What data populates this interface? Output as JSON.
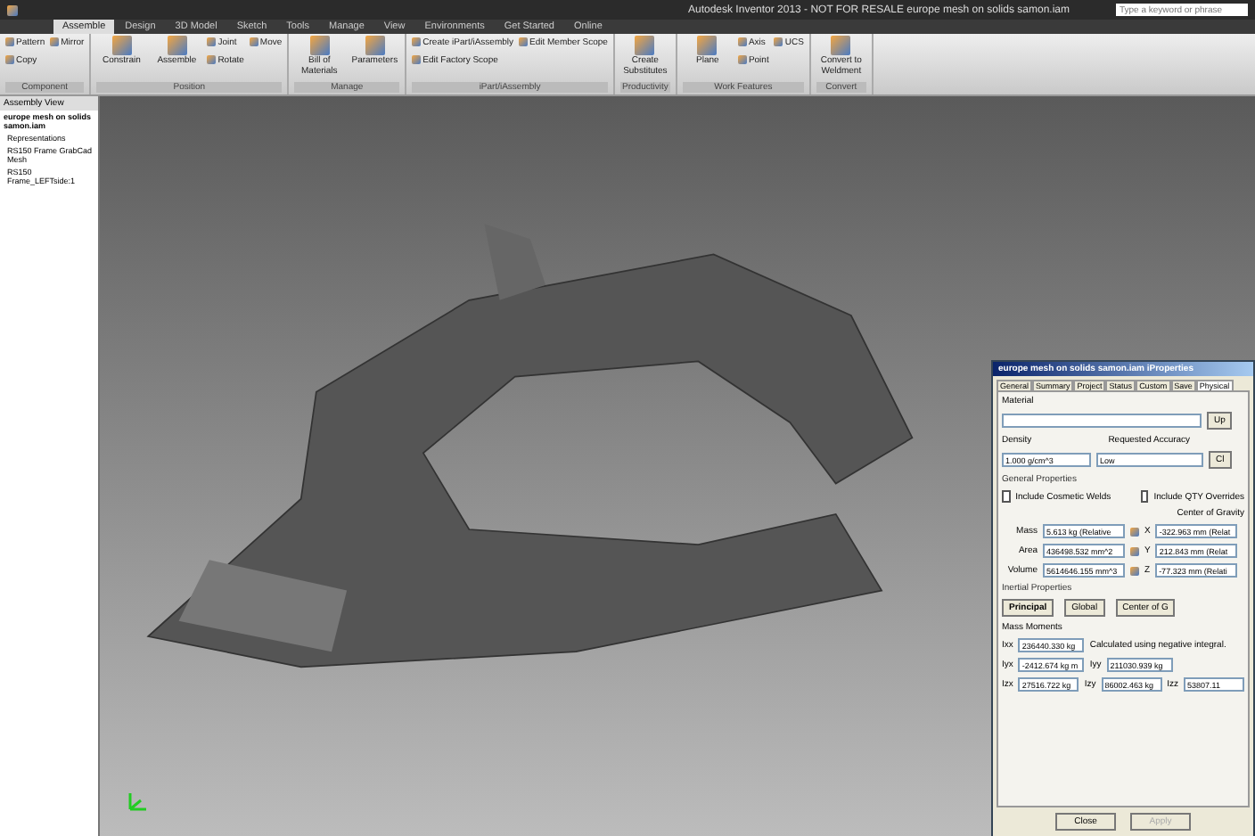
{
  "window": {
    "title": "Autodesk Inventor 2013 - NOT FOR RESALE   europe mesh on solids samon.iam",
    "search": {
      "placeholder": "Type a keyword or phrase"
    }
  },
  "tabs": [
    {
      "label": "Assemble",
      "selected": true
    },
    {
      "label": "Design",
      "selected": false
    },
    {
      "label": "3D Model",
      "selected": false
    },
    {
      "label": "Sketch",
      "selected": false
    },
    {
      "label": "Tools",
      "selected": false
    },
    {
      "label": "Manage",
      "selected": false
    },
    {
      "label": "View",
      "selected": false
    },
    {
      "label": "Environments",
      "selected": false
    },
    {
      "label": "Get Started",
      "selected": false
    },
    {
      "label": "Online",
      "selected": false
    }
  ],
  "ribbon": [
    {
      "label": "Component",
      "items": [
        {
          "label": "Pattern",
          "kind": "small"
        },
        {
          "label": "Copy",
          "kind": "small"
        },
        {
          "label": "Mirror",
          "kind": "small"
        }
      ]
    },
    {
      "label": "Position",
      "items": [
        {
          "label": "Constrain",
          "kind": "large"
        },
        {
          "label": "Assemble",
          "kind": "large"
        },
        {
          "label": "Joint",
          "kind": "small"
        },
        {
          "label": "Rotate",
          "kind": "small"
        },
        {
          "label": "Move",
          "kind": "small"
        }
      ]
    },
    {
      "label": "Manage",
      "items": [
        {
          "label": "Bill of Materials",
          "kind": "large"
        },
        {
          "label": "Parameters",
          "kind": "large"
        }
      ]
    },
    {
      "label": "iPart/iAssembly",
      "items": [
        {
          "label": "Create iPart/iAssembly",
          "kind": "small"
        },
        {
          "label": "Edit Factory Scope",
          "kind": "small"
        },
        {
          "label": "Edit Member Scope",
          "kind": "small"
        }
      ]
    },
    {
      "label": "Productivity",
      "items": [
        {
          "label": "Create Substitutes",
          "kind": "large"
        }
      ]
    },
    {
      "label": "Work Features",
      "items": [
        {
          "label": "Plane",
          "kind": "large"
        },
        {
          "label": "Axis",
          "kind": "small"
        },
        {
          "label": "Point",
          "kind": "small"
        },
        {
          "label": "UCS",
          "kind": "small"
        }
      ]
    },
    {
      "label": "Convert",
      "items": [
        {
          "label": "Convert to Weldment",
          "kind": "large"
        }
      ]
    }
  ],
  "browser": {
    "view": "Assembly View",
    "items": [
      {
        "label": "europe mesh on solids samon.iam",
        "children": [
          {
            "label": "Representations"
          },
          {
            "label": "RS150 Frame GrabCad Mesh"
          },
          {
            "label": "RS150 Frame_LEFTside:1"
          }
        ]
      }
    ]
  },
  "dialog": {
    "title": "europe mesh on solids samon.iam iProperties",
    "tabs": [
      {
        "label": "General",
        "selected": false
      },
      {
        "label": "Summary",
        "selected": false
      },
      {
        "label": "Project",
        "selected": false
      },
      {
        "label": "Status",
        "selected": false
      },
      {
        "label": "Custom",
        "selected": false
      },
      {
        "label": "Save",
        "selected": false
      },
      {
        "label": "Physical",
        "selected": true
      }
    ],
    "material_label": "Material",
    "update": "Up",
    "clipboard": "Cl",
    "density_label": "Density",
    "density": "1.000 g/cm^3",
    "accuracy_label": "Requested Accuracy",
    "accuracy": "Low",
    "general_label": "General Properties",
    "cosmetic": {
      "label": "Include Cosmetic Welds",
      "checked": false
    },
    "qty": {
      "label": "Include QTY Overrides",
      "checked": false
    },
    "cog_label": "Center of Gravity",
    "props": [
      {
        "label": "Mass",
        "value": "5.613 kg (Relative",
        "axis": "X",
        "cog": "-322.963 mm (Relat"
      },
      {
        "label": "Area",
        "value": "436498.532 mm^2",
        "axis": "Y",
        "cog": "212.843 mm (Relat"
      },
      {
        "label": "Volume",
        "value": "5614646.155 mm^3",
        "axis": "Z",
        "cog": "-77.323 mm (Relati"
      }
    ],
    "inertial_label": "Inertial Properties",
    "modes": [
      {
        "label": "Principal",
        "selected": true
      },
      {
        "label": "Global",
        "selected": false
      },
      {
        "label": "Center of G",
        "selected": false
      }
    ],
    "moments_label": "Mass Moments",
    "note": "Calculated using negative integral.",
    "moments": [
      [
        {
          "label": "Ixx",
          "value": "236440.330 kg"
        }
      ],
      [
        {
          "label": "Iyx",
          "value": "-2412.674 kg m"
        },
        {
          "label": "Iyy",
          "value": "211030.939 kg"
        }
      ],
      [
        {
          "label": "Izx",
          "value": "27516.722 kg"
        },
        {
          "label": "Izy",
          "value": "86002.463 kg"
        },
        {
          "label": "Izz",
          "value": "53807.11"
        }
      ]
    ],
    "buttons": [
      {
        "label": "Close",
        "disabled": false
      },
      {
        "label": "Apply",
        "disabled": true
      }
    ]
  }
}
